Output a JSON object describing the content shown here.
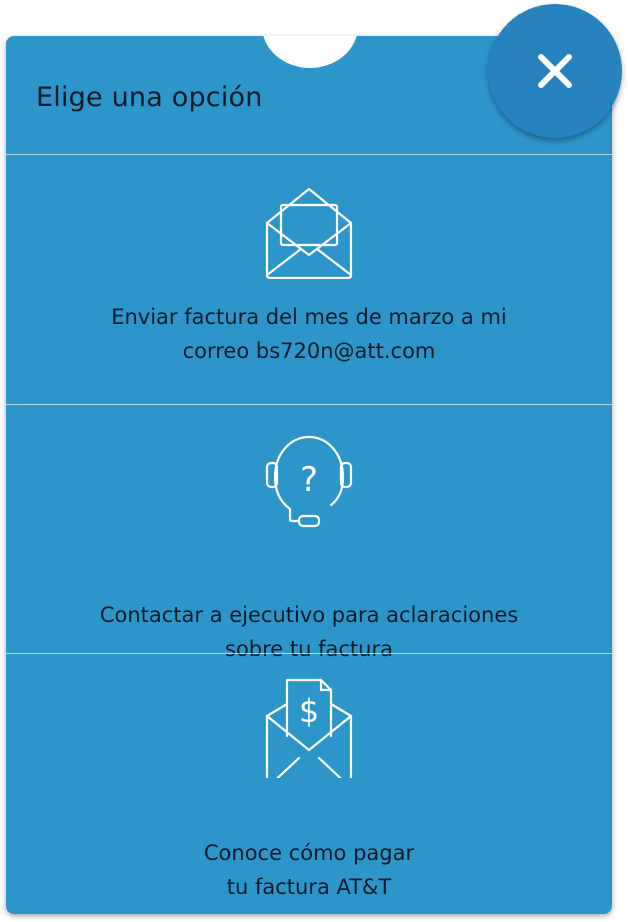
{
  "dialog": {
    "title": "Elige una opción",
    "close_icon": "close-icon"
  },
  "options": [
    {
      "line1": "Enviar factura del mes de marzo a mi",
      "line2": "correo bs720n@att.com",
      "icon": "open-envelope-icon"
    },
    {
      "line1": "Contactar a ejecutivo para aclaraciones",
      "line2": "sobre tu factura",
      "icon": "headset-question-icon"
    },
    {
      "line1": "Conoce cómo pagar",
      "line2": "tu factura AT&T",
      "icon": "envelope-bill-icon"
    }
  ],
  "colors": {
    "panel": "#2c96cb",
    "close_button": "#2683bd",
    "text": "#0d1a26",
    "icon_stroke": "#ffffff"
  }
}
